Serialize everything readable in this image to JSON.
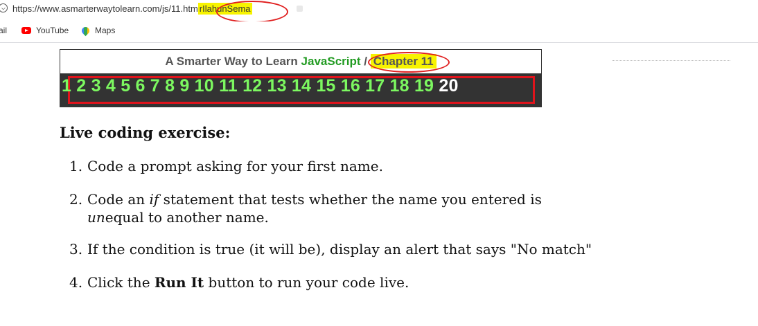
{
  "browser": {
    "url_prefix": "https://www.asmarterwaytolearn.com/js/11.htm",
    "url_highlight": "rIlahunSema"
  },
  "bookmarks": [
    {
      "label": "ail"
    },
    {
      "label": "YouTube",
      "icon": "youtube-icon"
    },
    {
      "label": "Maps",
      "icon": "maps-icon"
    }
  ],
  "banner": {
    "title_prefix": "A Smarter Way to Learn ",
    "title_js": "JavaScript",
    "separator": " / ",
    "chapter": "Chapter 11",
    "numbers": [
      "1",
      "2",
      "3",
      "4",
      "5",
      "6",
      "7",
      "8",
      "9",
      "10",
      "11",
      "12",
      "13",
      "14",
      "15",
      "16",
      "17",
      "18",
      "19",
      "20"
    ],
    "current": "20"
  },
  "content": {
    "heading": "Live coding exercise:",
    "steps": [
      {
        "num": "1.",
        "text": "Code a prompt asking for your first name."
      },
      {
        "num": "2.",
        "pre": "Code an ",
        "em1": "if",
        "mid": " statement that tests whether the name you entered is",
        "em2": "un",
        "post": "equal to another name."
      },
      {
        "num": "3.",
        "text": "If the condition is true (it will be), display an alert that says \"No match\""
      },
      {
        "num": "4.",
        "pre": "Click the ",
        "bold": "Run It",
        "post": " button to run your code live."
      }
    ]
  },
  "colors": {
    "highlight": "#f7f300",
    "annotation_red": "#e02020",
    "js_green": "#229b22",
    "number_green": "#7cf860",
    "bar_bg": "#333333"
  }
}
